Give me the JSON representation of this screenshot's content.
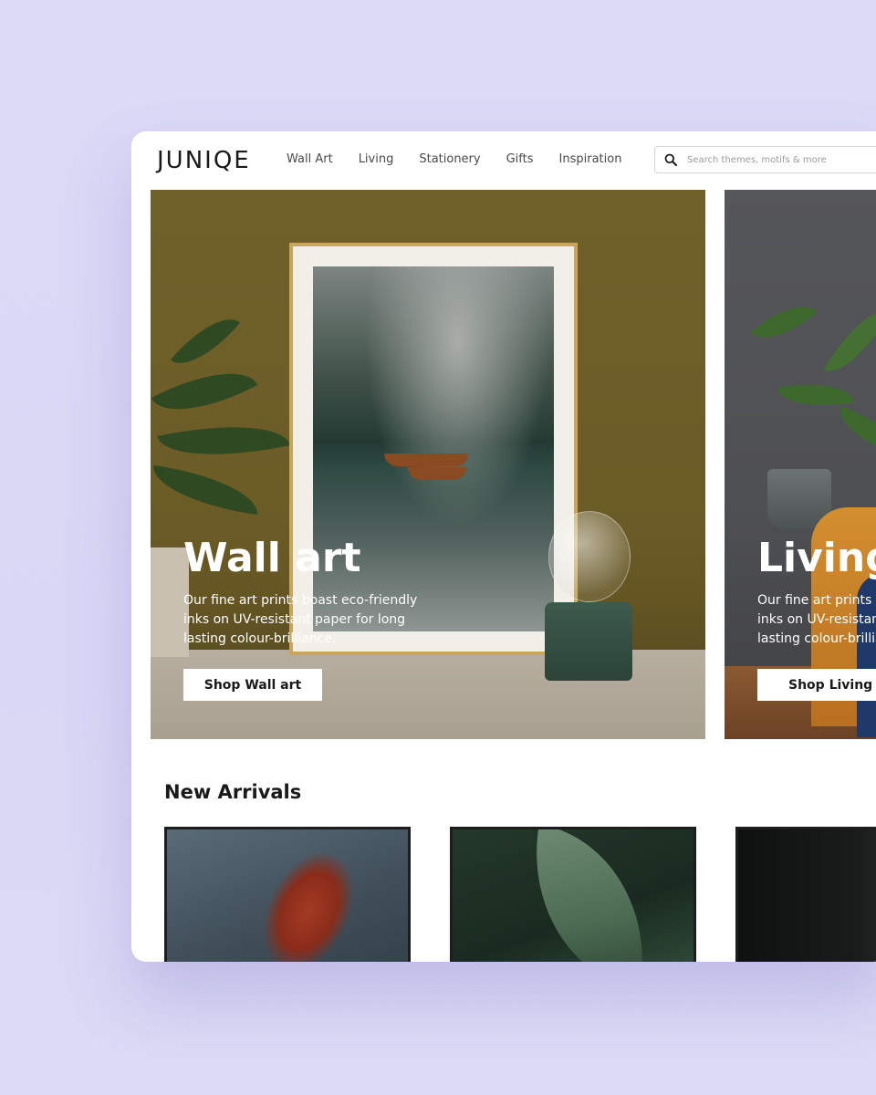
{
  "brand": {
    "logo": "JUNIQE"
  },
  "nav": {
    "items": [
      {
        "label": "Wall Art"
      },
      {
        "label": "Living"
      },
      {
        "label": "Stationery"
      },
      {
        "label": "Gifts"
      },
      {
        "label": "Inspiration"
      }
    ]
  },
  "search": {
    "placeholder": "Search themes, motifs & more"
  },
  "heroes": [
    {
      "title": "Wall art",
      "text": "Our fine art prints boast eco-friendly inks on UV-resistant paper for long lasting colour-brilliance.",
      "button": "Shop Wall art"
    },
    {
      "title": "Living",
      "text": "Our fine art prints boast eco-friendly inks on UV-resistant paper for long lasting colour-brilliance.",
      "button": "Shop Living"
    }
  ],
  "new_arrivals": {
    "title": "New Arrivals"
  },
  "colors": {
    "background": "#dcdaf6",
    "text": "#1a1a1a",
    "button_bg": "#ffffff"
  }
}
